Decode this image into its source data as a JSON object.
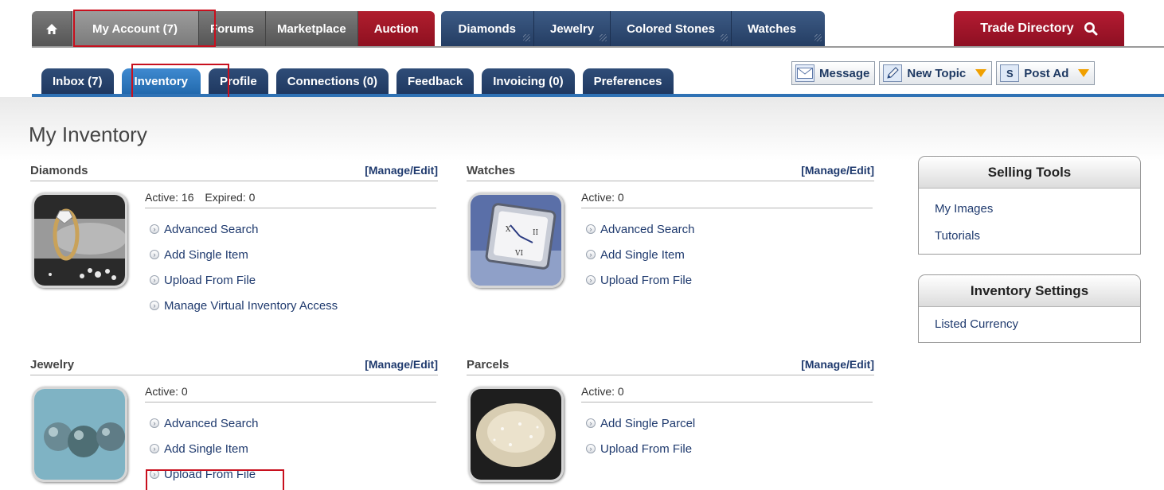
{
  "topnav": {
    "home_icon": "home-icon",
    "account": "My Account (7)",
    "forums": "Forums",
    "marketplace": "Marketplace",
    "auction": "Auction",
    "diamonds": "Diamonds",
    "jewelry": "Jewelry",
    "colored_stones": "Colored Stones",
    "watches": "Watches",
    "trade_directory": "Trade Directory",
    "search_icon": "search-icon"
  },
  "subnav": {
    "inbox": "Inbox (7)",
    "inventory": "Inventory",
    "profile": "Profile",
    "connections": "Connections (0)",
    "feedback": "Feedback",
    "invoicing": "Invoicing (0)",
    "preferences": "Preferences"
  },
  "actions": {
    "message": "Message",
    "new_topic": "New Topic",
    "post_ad": "Post Ad",
    "post_ad_icon_letter": "S"
  },
  "page": {
    "title": "My Inventory"
  },
  "sections": {
    "diamonds": {
      "title": "Diamonds",
      "manage": "[Manage/Edit]",
      "active": "Active: 16",
      "expired": "Expired: 0",
      "links": [
        "Advanced Search",
        "Add Single Item",
        "Upload From File",
        "Manage Virtual Inventory Access"
      ]
    },
    "watches": {
      "title": "Watches",
      "manage": "[Manage/Edit]",
      "active": "Active: 0",
      "links": [
        "Advanced Search",
        "Add Single Item",
        "Upload From File"
      ]
    },
    "jewelry": {
      "title": "Jewelry",
      "manage": "[Manage/Edit]",
      "active": "Active: 0",
      "links": [
        "Advanced Search",
        "Add Single Item",
        "Upload From File"
      ]
    },
    "parcels": {
      "title": "Parcels",
      "manage": "[Manage/Edit]",
      "active": "Active: 0",
      "links": [
        "Add Single Parcel",
        "Upload From File"
      ]
    }
  },
  "side": {
    "selling_tools": {
      "title": "Selling Tools",
      "items": [
        "My Images",
        "Tutorials"
      ]
    },
    "inventory_settings": {
      "title": "Inventory Settings",
      "items": [
        "Listed Currency"
      ]
    }
  },
  "colors": {
    "nav_gray": "#555555",
    "nav_red": "#8e1020",
    "nav_navy": "#243d63",
    "active_tab_blue": "#2269ad",
    "link_blue": "#1f3a6e",
    "highlight_red": "#c8101e",
    "arrow_orange": "#f0a000"
  }
}
